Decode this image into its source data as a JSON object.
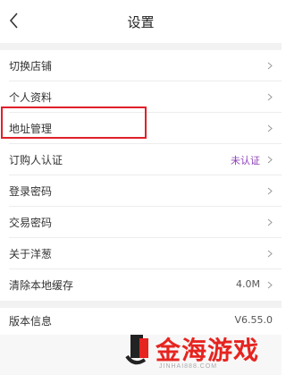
{
  "header": {
    "title": "设置",
    "back_icon": "chevron-left-icon"
  },
  "group1": [
    {
      "label": "切换店铺",
      "value": "",
      "chevron": true
    },
    {
      "label": "个人资料",
      "value": "",
      "chevron": true
    },
    {
      "label": "地址管理",
      "value": "",
      "chevron": true,
      "highlighted": true
    },
    {
      "label": "订购人认证",
      "value": "未认证",
      "chevron": true
    },
    {
      "label": "登录密码",
      "value": "",
      "chevron": true
    },
    {
      "label": "交易密码",
      "value": "",
      "chevron": true
    },
    {
      "label": "关于洋葱",
      "value": "",
      "chevron": true
    },
    {
      "label": "清除本地缓存",
      "value": "4.0M",
      "chevron": true
    }
  ],
  "group2": [
    {
      "label": "版本信息",
      "value": "V6.55.0",
      "chevron": false
    }
  ],
  "watermark": {
    "text": "金海游戏",
    "url": "JINHAI888.COM"
  },
  "colors": {
    "accent_purple": "#8e3fb8",
    "highlight_red": "#e0202a",
    "separator": "#f2f2f2",
    "watermark_red": "#e62420"
  }
}
